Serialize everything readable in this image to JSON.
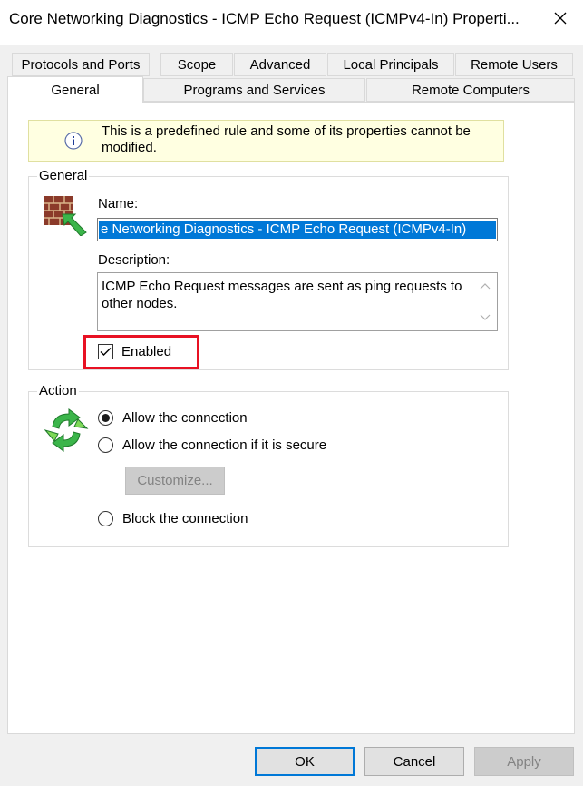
{
  "window": {
    "title": "Core Networking Diagnostics - ICMP Echo Request (ICMPv4-In) Properti...",
    "close_icon": "close-icon"
  },
  "tabs": {
    "row_top": [
      {
        "label": "Protocols and Ports"
      },
      {
        "label": "Scope"
      },
      {
        "label": "Advanced"
      },
      {
        "label": "Local Principals"
      },
      {
        "label": "Remote Users"
      }
    ],
    "row_bottom": [
      {
        "label": "General",
        "selected": true
      },
      {
        "label": "Programs and Services"
      },
      {
        "label": "Remote Computers"
      }
    ]
  },
  "info": {
    "icon": "info-icon",
    "text": "This is a predefined rule and some of its properties cannot be modified."
  },
  "general_group": {
    "label": "General",
    "icon": "firewall-rule-icon",
    "name_label": "Name:",
    "name_value": "e Networking Diagnostics - ICMP Echo Request (ICMPv4-In)",
    "description_label": "Description:",
    "description_value": "ICMP Echo Request messages are sent as ping requests to other nodes.",
    "enabled_label": "Enabled",
    "enabled_checked": true,
    "highlight_color": "#e81123"
  },
  "action_group": {
    "label": "Action",
    "icon": "refresh-arrows-icon",
    "options": [
      {
        "label": "Allow the connection",
        "selected": true
      },
      {
        "label": "Allow the connection if it is secure",
        "selected": false
      },
      {
        "label": "Block the connection",
        "selected": false
      }
    ],
    "customize_label": "Customize..."
  },
  "buttons": {
    "ok": "OK",
    "cancel": "Cancel",
    "apply": "Apply"
  },
  "colors": {
    "selection": "#0078d7",
    "info_background": "#ffffe1",
    "icon_green": "#3bb54a"
  }
}
